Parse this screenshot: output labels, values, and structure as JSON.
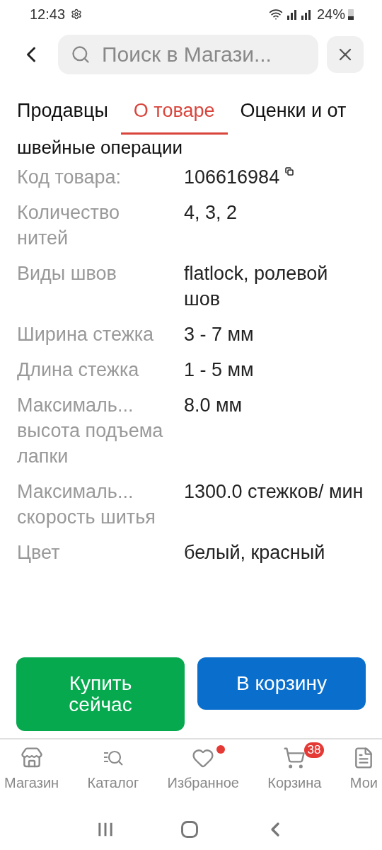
{
  "status_bar": {
    "time": "12:43",
    "battery": "24%"
  },
  "search": {
    "placeholder": "Поиск в Магази..."
  },
  "tabs": [
    {
      "label": "Продавцы",
      "selected": false
    },
    {
      "label": "О товаре",
      "selected": true
    },
    {
      "label": "Оценки и от",
      "selected": false
    }
  ],
  "section_heading": "швейные операции",
  "specs": [
    {
      "label": "Код товара:",
      "value": "106616984",
      "copyable": true
    },
    {
      "label": "Количество нитей",
      "value": "4, 3, 2",
      "copyable": false
    },
    {
      "label": "Виды швов",
      "value": "flatlock, ролевой шов",
      "copyable": false
    },
    {
      "label": "Ширина стежка",
      "value": "3 - 7 мм",
      "copyable": false
    },
    {
      "label": "Длина стежка",
      "value": "1 - 5 мм",
      "copyable": false
    },
    {
      "label": "Максималь... высота подъема лапки",
      "value": "8.0 мм",
      "copyable": false
    },
    {
      "label": "Максималь... скорость шитья",
      "value": "1300.0 стежков/ мин",
      "copyable": false
    },
    {
      "label": "Цвет",
      "value": "белый, красный",
      "copyable": false
    }
  ],
  "actions": [
    {
      "label": "Купить сейчас",
      "kind": "buy"
    },
    {
      "label": "В корзину",
      "kind": "cart"
    }
  ],
  "bottom_nav": [
    {
      "label": "Магазин",
      "dot": false
    },
    {
      "label": "Каталог",
      "dot": false
    },
    {
      "label": "Избранное",
      "dot": true
    },
    {
      "label": "Корзина",
      "dot": false,
      "badge": "38"
    },
    {
      "label": "Мои",
      "dot": false
    }
  ]
}
